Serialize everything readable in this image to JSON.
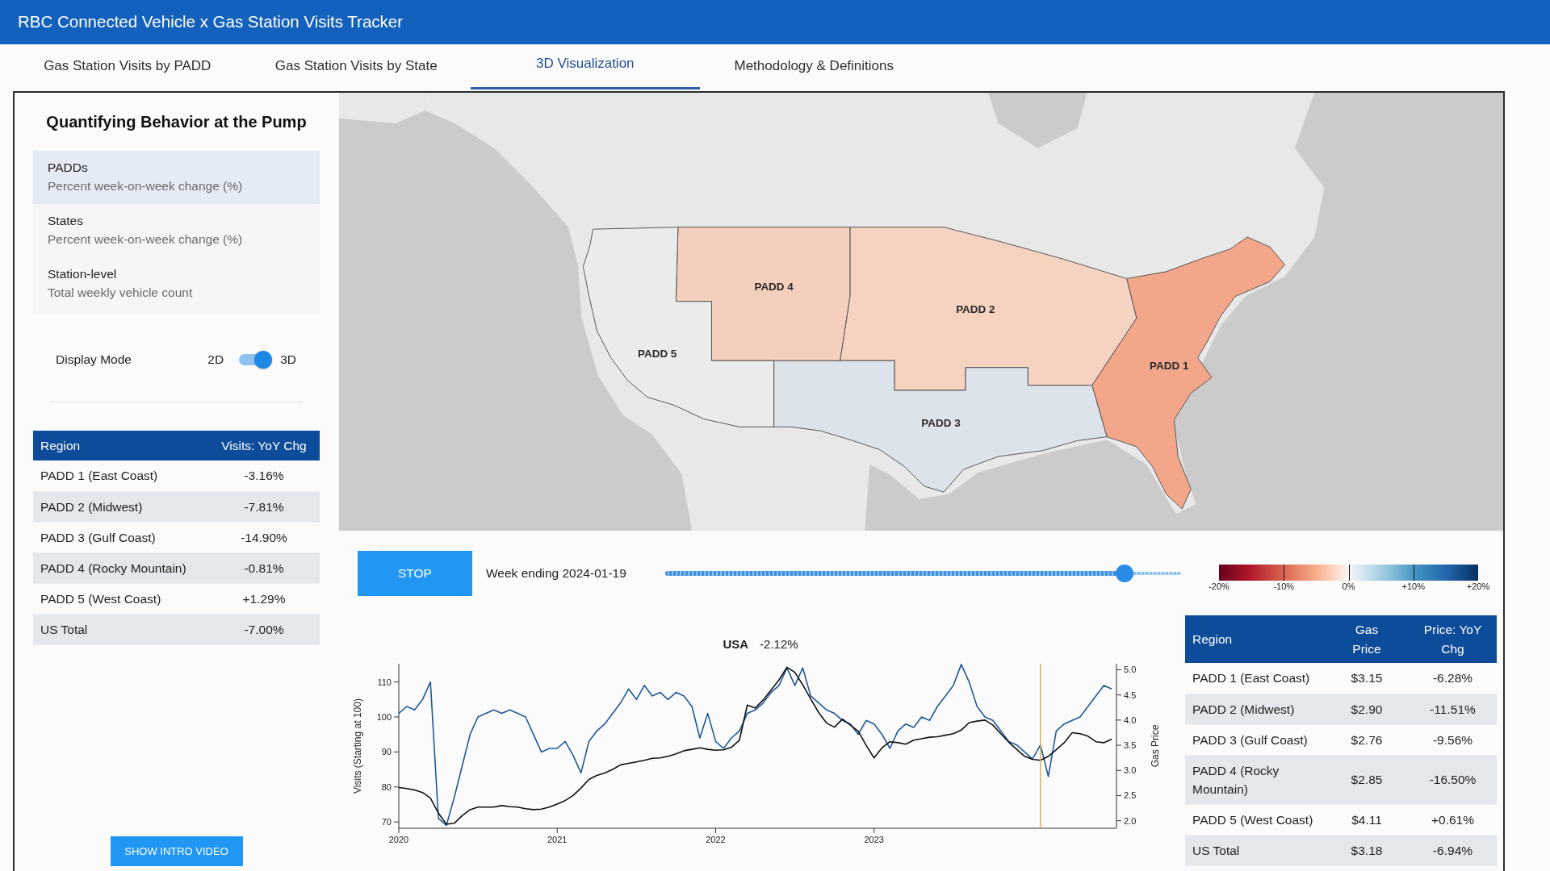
{
  "header": {
    "title": "RBC Connected Vehicle x Gas Station Visits Tracker"
  },
  "tabs": [
    {
      "label": "Gas Station Visits by PADD",
      "selected": false
    },
    {
      "label": "Gas Station Visits by State",
      "selected": false
    },
    {
      "label": "3D Visualization",
      "selected": true
    },
    {
      "label": "Methodology & Definitions",
      "selected": false
    }
  ],
  "sidebar": {
    "title": "Quantifying Behavior at the Pump",
    "layers": [
      {
        "name": "PADDs",
        "description": "Percent week-on-week change (%)",
        "selected": true
      },
      {
        "name": "States",
        "description": "Percent week-on-week change (%)",
        "selected": false
      },
      {
        "name": "Station-level",
        "description": "Total weekly vehicle count",
        "selected": false
      }
    ],
    "display_mode": {
      "label": "Display Mode",
      "off_label": "2D",
      "on_label": "3D",
      "on": true
    },
    "table": {
      "columns": [
        "Region",
        "Visits: YoY Chg"
      ],
      "rows": [
        [
          "PADD 1 (East Coast)",
          "-3.16%"
        ],
        [
          "PADD 2 (Midwest)",
          "-7.81%"
        ],
        [
          "PADD 3 (Gulf Coast)",
          "-14.90%"
        ],
        [
          "PADD 4 (Rocky Mountain)",
          "-0.81%"
        ],
        [
          "PADD 5 (West Coast)",
          "+1.29%"
        ],
        [
          "US Total",
          "-7.00%"
        ]
      ]
    },
    "video_button": "SHOW INTRO VIDEO"
  },
  "map": {
    "regions": [
      {
        "label": "PADD 1",
        "color": "#f3a689"
      },
      {
        "label": "PADD 2",
        "color": "#f6d2c1"
      },
      {
        "label": "PADD 3",
        "color": "#dde3ea"
      },
      {
        "label": "PADD 4",
        "color": "#f5cfbd"
      },
      {
        "label": "PADD 5",
        "color": "#ebebeb"
      }
    ]
  },
  "playback": {
    "button": "STOP",
    "week_label": "Week ending 2024-01-19",
    "slider": {
      "level": 0.89
    },
    "legend": {
      "labels": [
        "-20%",
        "-10%",
        "0%",
        "+10%",
        "+20%"
      ]
    }
  },
  "chart": {
    "change": "-2.12%",
    "chart_data": {
      "type": "line",
      "title": "USA",
      "ylabel": "Visits (Starting at 100)",
      "y2label": "Gas Price",
      "x": [
        2020,
        2020.05,
        2020.1,
        2020.15,
        2020.2,
        2020.25,
        2020.3,
        2020.35,
        2020.4,
        2020.45,
        2020.5,
        2020.55,
        2020.6,
        2020.65,
        2020.7,
        2020.75,
        2020.8,
        2020.85,
        2020.9,
        2020.95,
        2021,
        2021.05,
        2021.1,
        2021.15,
        2021.2,
        2021.25,
        2021.3,
        2021.35,
        2021.4,
        2021.45,
        2021.5,
        2021.55,
        2021.6,
        2021.65,
        2021.7,
        2021.75,
        2021.8,
        2021.85,
        2021.9,
        2021.95,
        2022,
        2022.05,
        2022.1,
        2022.15,
        2022.2,
        2022.25,
        2022.3,
        2022.35,
        2022.4,
        2022.45,
        2022.5,
        2022.55,
        2022.6,
        2022.65,
        2022.7,
        2022.75,
        2022.8,
        2022.85,
        2022.9,
        2022.95,
        2023,
        2023.05,
        2023.1,
        2023.15,
        2023.2,
        2023.25,
        2023.3,
        2023.35,
        2023.4,
        2023.45,
        2023.5,
        2023.55,
        2023.6,
        2023.65,
        2023.7,
        2023.75,
        2023.8,
        2023.85,
        2023.9,
        2023.95,
        2024,
        2024.05,
        2024.1,
        2024.15,
        2024.2,
        2024.25,
        2024.3,
        2024.35,
        2024.4,
        2024.45,
        2024.5
      ],
      "xlim": [
        2020,
        2024.53
      ],
      "xticks": [
        2020,
        2021,
        2022,
        2023
      ],
      "ylim": [
        68.2,
        115.2
      ],
      "yticks": [
        70,
        80,
        90,
        100,
        110
      ],
      "y2lim": [
        1.85,
        5.12
      ],
      "y2ticks": [
        {
          "value": 2,
          "label": "2.0"
        },
        2.5,
        {
          "value": 3,
          "label": "3.0"
        },
        3.5,
        {
          "value": 4,
          "label": "4.0"
        },
        4.5,
        {
          "value": 5,
          "label": "5.0"
        }
      ],
      "series": [
        {
          "color": "#1f5a96",
          "values": [
            101,
            103,
            102,
            105,
            110,
            71,
            69,
            77,
            86,
            95,
            100,
            101,
            102,
            101,
            102,
            101,
            100,
            95,
            90,
            91,
            91,
            93,
            89,
            84,
            93,
            96,
            98,
            101,
            104,
            108,
            105,
            109,
            106,
            107,
            105,
            107,
            106,
            103,
            94,
            101,
            93,
            91,
            94,
            96,
            101,
            102,
            104,
            107,
            109,
            114,
            109,
            114,
            106,
            104,
            102,
            101,
            99,
            98,
            95,
            99,
            98,
            95,
            91,
            96,
            98,
            97,
            100,
            99,
            103,
            106,
            109,
            115,
            110,
            103,
            100,
            99,
            96,
            93,
            92,
            90,
            88,
            92,
            83,
            96,
            98,
            99,
            100,
            103,
            106,
            109,
            108
          ]
        },
        {
          "axis": "y2",
          "color": "#111111",
          "values": [
            2.66,
            2.64,
            2.61,
            2.56,
            2.45,
            2.15,
            1.93,
            1.95,
            2.1,
            2.22,
            2.27,
            2.27,
            2.27,
            2.3,
            2.28,
            2.27,
            2.24,
            2.22,
            2.23,
            2.27,
            2.33,
            2.4,
            2.5,
            2.65,
            2.82,
            2.9,
            2.95,
            3.02,
            3.11,
            3.14,
            3.17,
            3.2,
            3.24,
            3.25,
            3.28,
            3.33,
            3.39,
            3.42,
            3.45,
            3.42,
            3.4,
            3.41,
            3.46,
            3.6,
            4.3,
            4.24,
            4.4,
            4.6,
            4.8,
            5.05,
            4.95,
            4.7,
            4.42,
            4.15,
            3.94,
            3.86,
            4.02,
            3.9,
            3.78,
            3.5,
            3.25,
            3.45,
            3.57,
            3.55,
            3.52,
            3.6,
            3.63,
            3.66,
            3.67,
            3.7,
            3.73,
            3.8,
            3.95,
            3.98,
            4.0,
            3.9,
            3.73,
            3.56,
            3.42,
            3.28,
            3.22,
            3.2,
            3.28,
            3.41,
            3.55,
            3.75,
            3.73,
            3.68,
            3.57,
            3.55,
            3.62
          ]
        }
      ],
      "ref_lines": [
        {
          "axis": "x",
          "value": 2024.05
        }
      ]
    }
  },
  "price_table": {
    "columns": [
      "Region",
      "Gas Price",
      "Price: YoY Chg"
    ],
    "rows": [
      [
        "PADD 1 (East Coast)",
        "$3.15",
        "-6.28%"
      ],
      [
        "PADD 2 (Midwest)",
        "$2.90",
        "-11.51%"
      ],
      [
        "PADD 3 (Gulf Coast)",
        "$2.76",
        "-9.56%"
      ],
      [
        "PADD 4 (Rocky Mountain)",
        "$2.85",
        "-16.50%"
      ],
      [
        "PADD 5 (West Coast)",
        "$4.11",
        "+0.61%"
      ],
      [
        "US Total",
        "$3.18",
        "-6.94%"
      ]
    ]
  }
}
